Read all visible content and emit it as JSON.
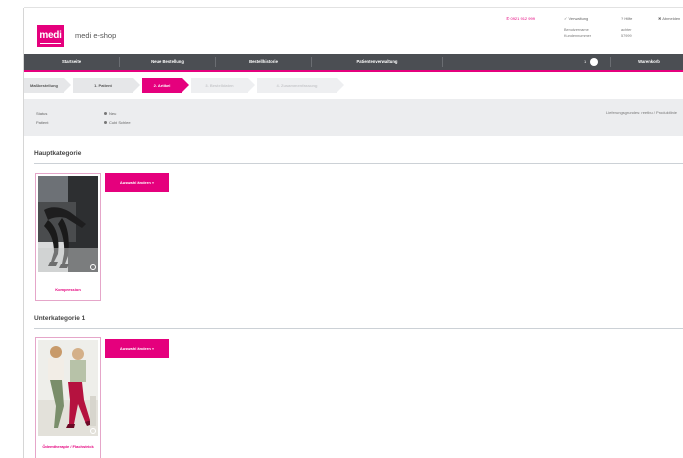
{
  "header": {
    "logo_text": "medi",
    "shop_title": "medi e-shop",
    "phone": "0921 912 999",
    "admin_link": "Verwaltung",
    "help_link": "Hilfe",
    "logout_link": "Abmelden",
    "user_labels": [
      "Benutzername",
      "Kundennummer"
    ],
    "user_values": [
      "achter",
      "57999"
    ]
  },
  "nav": {
    "items": [
      "Startseite",
      "Neue Bestellung",
      "Bestellhistorie",
      "Patientenverwaltung"
    ],
    "cart_label": "Warenkorb",
    "cart_count": "1"
  },
  "steps": [
    {
      "label": "Maßbestellung",
      "state": "done"
    },
    {
      "label": "1. Patient",
      "state": "done"
    },
    {
      "label": "2. Artikel",
      "state": "active"
    },
    {
      "label": "3. Bestelldaten",
      "state": "disabled"
    },
    {
      "label": "4. Zusammenfassung",
      "state": "disabled"
    }
  ],
  "info": {
    "status_label": "Status",
    "status_value": "Neu",
    "patient_label": "Patient",
    "patient_value": "Cubi Schlee",
    "right_text": "Lieferungsgrundes: reetbu / Produktlinie"
  },
  "sections": [
    {
      "title": "Hauptkategorie",
      "tile_caption": "Kompression",
      "button": "Auswahl ändern »"
    },
    {
      "title": "Unterkategorie 1",
      "tile_caption": "Ödemtherapie / Flachstrick",
      "button": "Auswahl ändern »"
    }
  ],
  "colors": {
    "accent": "#e5007d",
    "nav_bg": "#4b4e53"
  }
}
